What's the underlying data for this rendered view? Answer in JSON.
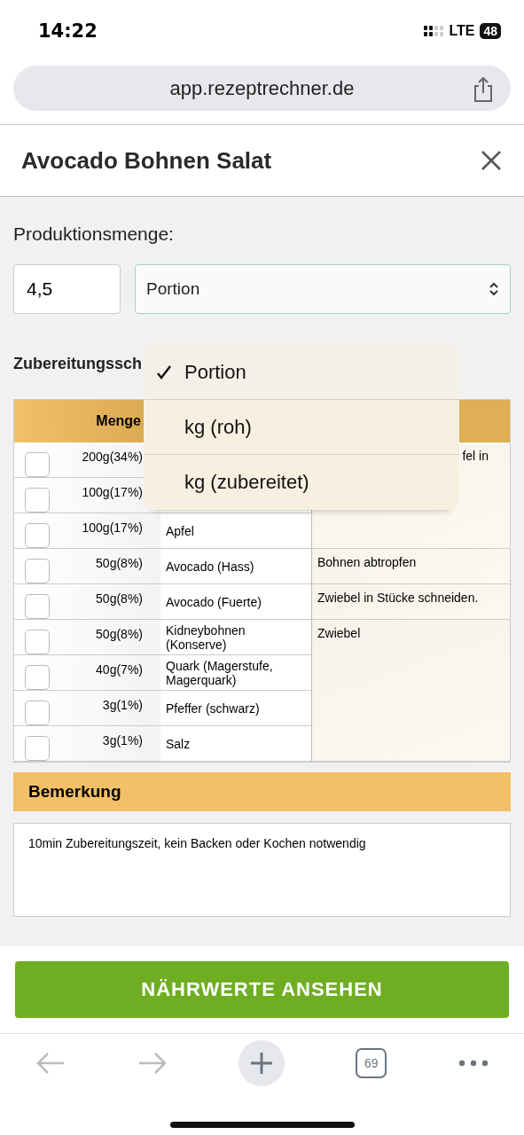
{
  "status_bar": {
    "time": "14:22",
    "network": "LTE",
    "battery": "48"
  },
  "browser": {
    "url": "app.rezeptrechner.de",
    "tab_count": "69"
  },
  "dialog": {
    "title": "Avocado Bohnen Salat"
  },
  "production": {
    "label": "Produktionsmenge:",
    "amount": "4,5",
    "unit": "Portion"
  },
  "unit_menu": {
    "options": [
      {
        "label": "Portion",
        "selected": true
      },
      {
        "label": "kg (roh)",
        "selected": false
      },
      {
        "label": "kg (zubereitet)",
        "selected": false
      }
    ]
  },
  "preparation": {
    "heading": "Zubereitungssch",
    "columns": [
      "Menge"
    ],
    "rows": [
      {
        "amount": "200g(34%)",
        "checked": false,
        "step": "fel in"
      },
      {
        "amount": "100g(17%)",
        "checked": false
      },
      {
        "amount": "100g(17%)",
        "ingredient": "Apfel",
        "checked": false
      },
      {
        "amount": "50g(8%)",
        "ingredient": "Avocado (Hass)",
        "checked": false,
        "step": "Bohnen abtropfen"
      },
      {
        "amount": "50g(8%)",
        "ingredient": "Avocado (Fuerte)",
        "checked": false,
        "step": "Zwiebel in Stücke schneiden."
      },
      {
        "amount": "50g(8%)",
        "ingredient": "Kidneybohnen (Konserve)",
        "checked": false,
        "step": "Zwiebel"
      },
      {
        "amount": "40g(7%)",
        "ingredient": "Quark (Magerstufe, Magerquark)",
        "checked": false
      },
      {
        "amount": "3g(1%)",
        "ingredient": "Pfeffer (schwarz)",
        "checked": false
      },
      {
        "amount": "3g(1%)",
        "ingredient": "Salz",
        "checked": false
      }
    ]
  },
  "remark": {
    "heading": "Bemerkung",
    "text": "10min Zubereitungszeit, kein Backen oder Kochen notwendig"
  },
  "action_button": "NÄHRWERTE ANSEHEN"
}
